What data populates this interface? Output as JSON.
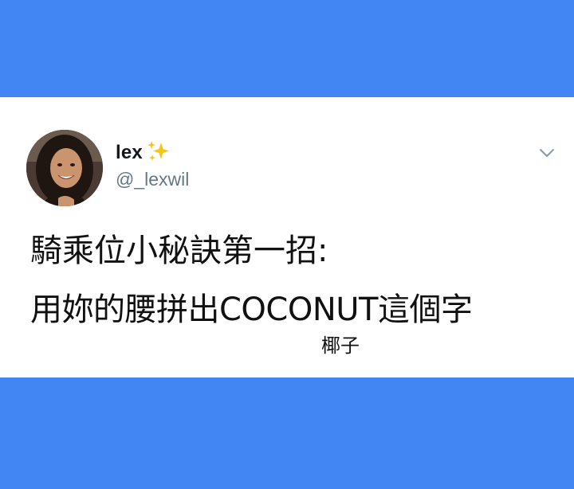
{
  "theme": {
    "background": "#4286f4",
    "card": "#ffffff",
    "text": "#14171a",
    "muted": "#657786",
    "sparkle": "#f5c518"
  },
  "tweet": {
    "author": {
      "display_name": "lex",
      "emoji_icon": "sparkles-icon",
      "handle": "@_lexwil",
      "avatar_icon": "avatar"
    },
    "menu_icon": "chevron-down-icon",
    "text_lines": [
      "騎乘位小秘訣第一招:",
      "用妳的腰拼出COCONUT這個字"
    ],
    "caption": "椰子"
  }
}
